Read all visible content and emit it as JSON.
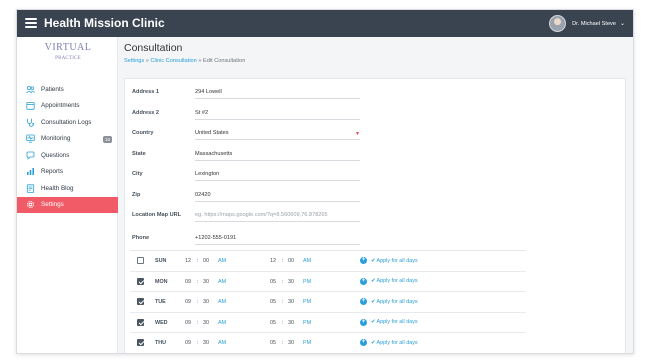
{
  "app": {
    "title": "Health Mission Clinic"
  },
  "user": {
    "name": "Dr. Michael Steve"
  },
  "logo": {
    "main": "VIRTUAL",
    "sub": "PRACTICE"
  },
  "sidebar": {
    "items": [
      {
        "label": "Patients",
        "icon": "patients-icon"
      },
      {
        "label": "Appointments",
        "icon": "calendar-icon"
      },
      {
        "label": "Consultation Logs",
        "icon": "stethoscope-icon"
      },
      {
        "label": "Monitoring",
        "icon": "monitor-icon",
        "badge": "16"
      },
      {
        "label": "Questions",
        "icon": "chat-icon"
      },
      {
        "label": "Reports",
        "icon": "reports-icon"
      },
      {
        "label": "Health Blog",
        "icon": "blog-icon"
      },
      {
        "label": "Settings",
        "icon": "gear-icon",
        "active": true
      }
    ]
  },
  "page": {
    "title": "Consultation",
    "breadcrumb": {
      "first": "Settings",
      "second": "Clinic Consultation",
      "third": "Edit Consultation"
    }
  },
  "form": {
    "address1": {
      "label": "Address 1",
      "value": "294 Lowell"
    },
    "address2": {
      "label": "Address 2",
      "value": "St #2"
    },
    "country": {
      "label": "Country",
      "value": "United States"
    },
    "state": {
      "label": "State",
      "value": "Massachusetts"
    },
    "city": {
      "label": "City",
      "value": "Lexington"
    },
    "zip": {
      "label": "Zip",
      "value": "02420"
    },
    "map": {
      "label": "Location Map URL",
      "placeholder": "eg. https://maps.google.com/?q=8.560609,76.878265"
    },
    "phone": {
      "label": "Phone",
      "value": "+1202-555-0191"
    }
  },
  "schedule": {
    "apply_label": "Apply for all days",
    "rows": [
      {
        "day": "SUN",
        "checked": false,
        "from_h": "12",
        "from_m": "00",
        "from_ap": "AM",
        "to_h": "12",
        "to_m": "00",
        "to_ap": "AM"
      },
      {
        "day": "MON",
        "checked": true,
        "from_h": "09",
        "from_m": "30",
        "from_ap": "AM",
        "to_h": "05",
        "to_m": "30",
        "to_ap": "PM"
      },
      {
        "day": "TUE",
        "checked": true,
        "from_h": "09",
        "from_m": "30",
        "from_ap": "AM",
        "to_h": "05",
        "to_m": "30",
        "to_ap": "PM"
      },
      {
        "day": "WED",
        "checked": true,
        "from_h": "09",
        "from_m": "30",
        "from_ap": "AM",
        "to_h": "05",
        "to_m": "30",
        "to_ap": "PM"
      },
      {
        "day": "THU",
        "checked": true,
        "from_h": "09",
        "from_m": "30",
        "from_ap": "AM",
        "to_h": "05",
        "to_m": "30",
        "to_ap": "PM"
      }
    ]
  },
  "colors": {
    "topbar": "#3a4450",
    "active": "#f05b67",
    "link": "#2a9fd8"
  }
}
